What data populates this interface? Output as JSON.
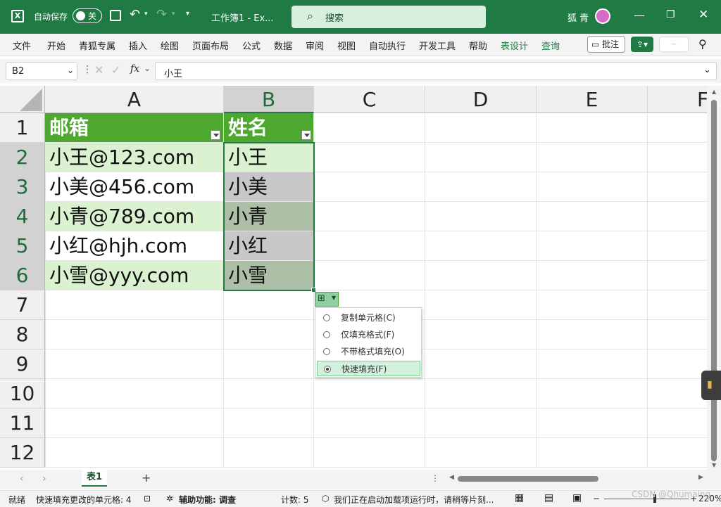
{
  "titlebar": {
    "autosave_label": "自动保存",
    "autosave_state": "关",
    "doc_title": "工作簿1 - Ex...",
    "search_placeholder": "搜索",
    "user_name": "狐 青"
  },
  "ribbon": {
    "tabs": [
      "文件",
      "开始",
      "青狐专属",
      "插入",
      "绘图",
      "页面布局",
      "公式",
      "数据",
      "审阅",
      "视图",
      "自动执行",
      "开发工具",
      "帮助",
      "表设计",
      "查询"
    ],
    "comment_button": "批注"
  },
  "formula_bar": {
    "name_box": "B2",
    "fx_label": "fx",
    "formula": "小王"
  },
  "columns": [
    "A",
    "B",
    "C",
    "D",
    "E",
    "F"
  ],
  "rows": [
    "1",
    "2",
    "3",
    "4",
    "5",
    "6",
    "7",
    "8",
    "9",
    "10",
    "11",
    "12"
  ],
  "table": {
    "header": [
      "邮箱",
      "姓名"
    ],
    "emails": [
      "小王@123.com",
      "小美@456.com",
      "小青@789.com",
      "小红@hjh.com",
      "小雪@yyy.com"
    ],
    "names": [
      "小王",
      "小美",
      "小青",
      "小红",
      "小雪"
    ]
  },
  "autofill_menu": {
    "items": [
      "复制单元格(C)",
      "仅填充格式(F)",
      "不带格式填充(O)",
      "快速填充(F)"
    ],
    "selected_index": 3
  },
  "sheets": {
    "tabs": [
      "表1"
    ],
    "add": "+"
  },
  "statusbar": {
    "ready": "就绪",
    "flash_fill": "快速填充更改的单元格: 4",
    "accessibility": "辅助功能: 调查",
    "count": "计数: 5",
    "addins": "我们正在启动加载项运行时，请稍等片刻...",
    "zoom": "220%",
    "watermark": "CSDN @Qhumaing"
  },
  "colors": {
    "accent": "#1f7a44",
    "table_header": "#4ea72e",
    "band": "#daf2d0"
  }
}
